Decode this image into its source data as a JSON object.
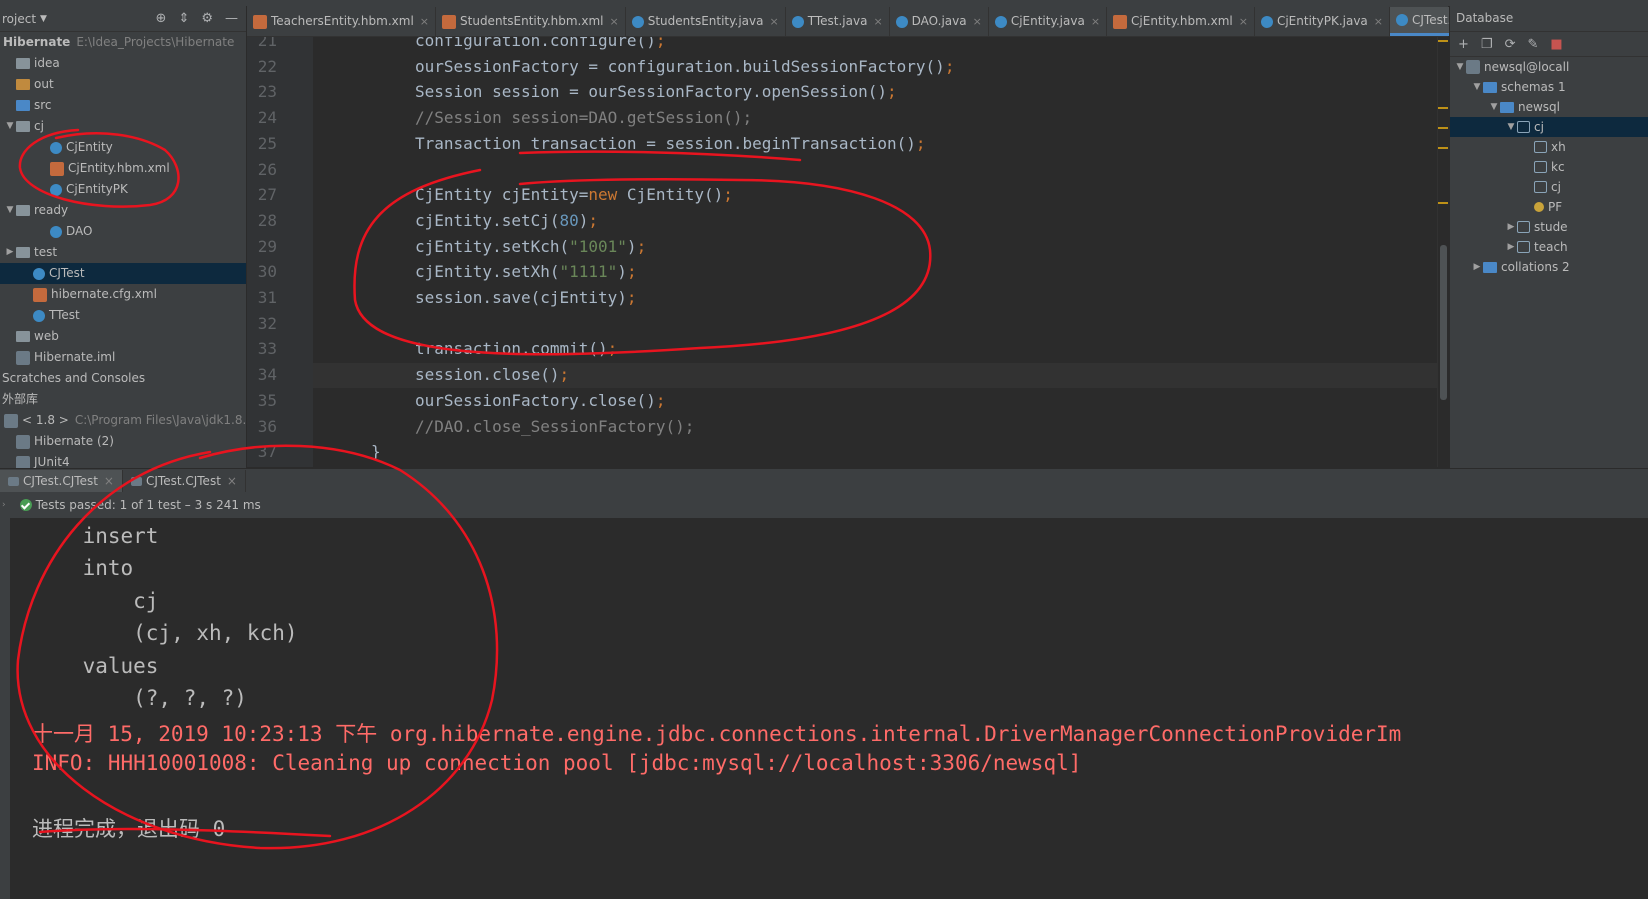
{
  "project": {
    "title": "roject",
    "root_name": "Hibernate",
    "root_path": "E:\\Idea_Projects\\Hibernate",
    "items": [
      {
        "label": "idea",
        "arrow": "",
        "depth": 0,
        "icon": "folder"
      },
      {
        "label": "out",
        "arrow": "",
        "depth": 0,
        "icon": "folder-orange"
      },
      {
        "label": "src",
        "arrow": "",
        "depth": 0,
        "icon": "folder-blue"
      },
      {
        "label": "cj",
        "arrow": "▼",
        "depth": 0,
        "icon": "package"
      },
      {
        "label": "CjEntity",
        "arrow": "",
        "depth": 2,
        "icon": "class"
      },
      {
        "label": "CjEntity.hbm.xml",
        "arrow": "",
        "depth": 2,
        "icon": "xml"
      },
      {
        "label": "CjEntityPK",
        "arrow": "",
        "depth": 2,
        "icon": "class"
      },
      {
        "label": "ready",
        "arrow": "▼",
        "depth": 0,
        "icon": "package"
      },
      {
        "label": "DAO",
        "arrow": "",
        "depth": 2,
        "icon": "class"
      },
      {
        "label": "test",
        "arrow": "▶",
        "depth": 0,
        "icon": "package"
      },
      {
        "label": "CJTest",
        "arrow": "",
        "depth": 1,
        "icon": "class",
        "selected": true
      },
      {
        "label": "hibernate.cfg.xml",
        "arrow": "",
        "depth": 1,
        "icon": "xml"
      },
      {
        "label": "TTest",
        "arrow": "",
        "depth": 1,
        "icon": "class"
      },
      {
        "label": "web",
        "arrow": "",
        "depth": 0,
        "icon": "folder"
      },
      {
        "label": "Hibernate.iml",
        "arrow": "",
        "depth": 0,
        "icon": "lib"
      },
      {
        "label": "Scratches and Consoles",
        "arrow": "",
        "depth": -1,
        "icon": ""
      },
      {
        "label": "外部库",
        "arrow": "",
        "depth": -1,
        "icon": ""
      },
      {
        "label": "< 1.8 >",
        "arrow": "",
        "depth": 0,
        "icon": "lib",
        "path": "C:\\Program Files\\Java\\jdk1.8.0_"
      },
      {
        "label": "Hibernate (2)",
        "arrow": "",
        "depth": 0,
        "icon": "lib"
      },
      {
        "label": "JUnit4",
        "arrow": "",
        "depth": 0,
        "icon": "lib"
      }
    ]
  },
  "tabs": [
    {
      "label": "TeachersEntity.hbm.xml",
      "icon": "xml"
    },
    {
      "label": "StudentsEntity.hbm.xml",
      "icon": "xml"
    },
    {
      "label": "StudentsEntity.java",
      "icon": "class"
    },
    {
      "label": "TTest.java",
      "icon": "class"
    },
    {
      "label": "DAO.java",
      "icon": "class"
    },
    {
      "label": "CjEntity.java",
      "icon": "class"
    },
    {
      "label": "CjEntity.hbm.xml",
      "icon": "xml"
    },
    {
      "label": "CjEntityPK.java",
      "icon": "class"
    },
    {
      "label": "CJTest.java",
      "icon": "class",
      "active": true
    }
  ],
  "tab_close": "×",
  "tab_overflow": "≡",
  "editor": {
    "lines": [
      {
        "no": "21",
        "html": "configuration.configure()<span class='k'>;</span>"
      },
      {
        "no": "22",
        "html": "ourSessionFactory = configuration.buildSessionFactory()<span class='k'>;</span>"
      },
      {
        "no": "23",
        "html": "Session session = ourSessionFactory.openSession()<span class='k'>;</span>"
      },
      {
        "no": "24",
        "html": "<span class='c'>//Session session=DAO.getSession();</span>"
      },
      {
        "no": "25",
        "html": "Transaction transaction = session.beginTransaction()<span class='k'>;</span>"
      },
      {
        "no": "26",
        "html": ""
      },
      {
        "no": "27",
        "html": "CjEntity cjEntity=<span class='k'>new</span> CjEntity()<span class='k'>;</span>"
      },
      {
        "no": "28",
        "html": "cjEntity.setCj(<span class='n'>80</span>)<span class='k'>;</span>"
      },
      {
        "no": "29",
        "html": "cjEntity.setKch(<span class='s'>\"1001\"</span>)<span class='k'>;</span>"
      },
      {
        "no": "30",
        "html": "cjEntity.setXh(<span class='s'>\"1111\"</span>)<span class='k'>;</span>"
      },
      {
        "no": "31",
        "html": "session.save(cjEntity)<span class='k'>;</span>"
      },
      {
        "no": "32",
        "html": ""
      },
      {
        "no": "33",
        "html": "transaction.commit()<span class='k'>;</span>"
      },
      {
        "no": "34",
        "html": "session.close()<span class='k'>;</span>"
      },
      {
        "no": "35",
        "html": "ourSessionFactory.close()<span class='k'>;</span>"
      },
      {
        "no": "36",
        "html": "<span class='c'>//DAO.close_SessionFactory();</span>"
      },
      {
        "no": "37",
        "html": "}"
      }
    ]
  },
  "database": {
    "title": "Database",
    "rows": [
      {
        "label": "newsql@locall",
        "arrow": "▼",
        "depth": 0,
        "icon": "db"
      },
      {
        "label": "schemas 1",
        "arrow": "▼",
        "depth": 1,
        "icon": "folder-blue"
      },
      {
        "label": "newsql",
        "arrow": "▼",
        "depth": 2,
        "icon": "schema"
      },
      {
        "label": "cj",
        "arrow": "▼",
        "depth": 3,
        "icon": "table",
        "selected": true
      },
      {
        "label": "xh",
        "arrow": "",
        "depth": 4,
        "icon": "column"
      },
      {
        "label": "kc",
        "arrow": "",
        "depth": 4,
        "icon": "column"
      },
      {
        "label": "cj",
        "arrow": "",
        "depth": 4,
        "icon": "column"
      },
      {
        "label": "PF",
        "arrow": "",
        "depth": 4,
        "icon": "key"
      },
      {
        "label": "stude",
        "arrow": "▶",
        "depth": 3,
        "icon": "table"
      },
      {
        "label": "teach",
        "arrow": "▶",
        "depth": 3,
        "icon": "table"
      },
      {
        "label": "collations 2",
        "arrow": "▶",
        "depth": 1,
        "icon": "folder-blue"
      }
    ]
  },
  "run": {
    "tabs": [
      {
        "label": "CJTest.CJTest",
        "active": true
      },
      {
        "label": "CJTest.CJTest",
        "active": false
      }
    ],
    "status": "Tests passed: 1 of 1 test – 3 s 241 ms",
    "console": [
      {
        "text": "    insert",
        "err": false
      },
      {
        "text": "    into",
        "err": false
      },
      {
        "text": "        cj",
        "err": false
      },
      {
        "text": "        (cj, xh, kch)",
        "err": false
      },
      {
        "text": "    values",
        "err": false
      },
      {
        "text": "        (?, ?, ?)",
        "err": false
      },
      {
        "text": "十一月 15, 2019 10:23:13 下午 org.hibernate.engine.jdbc.connections.internal.DriverManagerConnectionProviderIm",
        "err": true
      },
      {
        "text": "INFO: HHH10001008: Cleaning up connection pool [jdbc:mysql://localhost:3306/newsql]",
        "err": true
      },
      {
        "text": "",
        "err": false
      },
      {
        "text": "进程完成，退出码 0",
        "err": false
      }
    ]
  },
  "colors": {
    "annotation": "#e8141f",
    "accent": "#4a88c7",
    "error": "#ff6b68"
  }
}
